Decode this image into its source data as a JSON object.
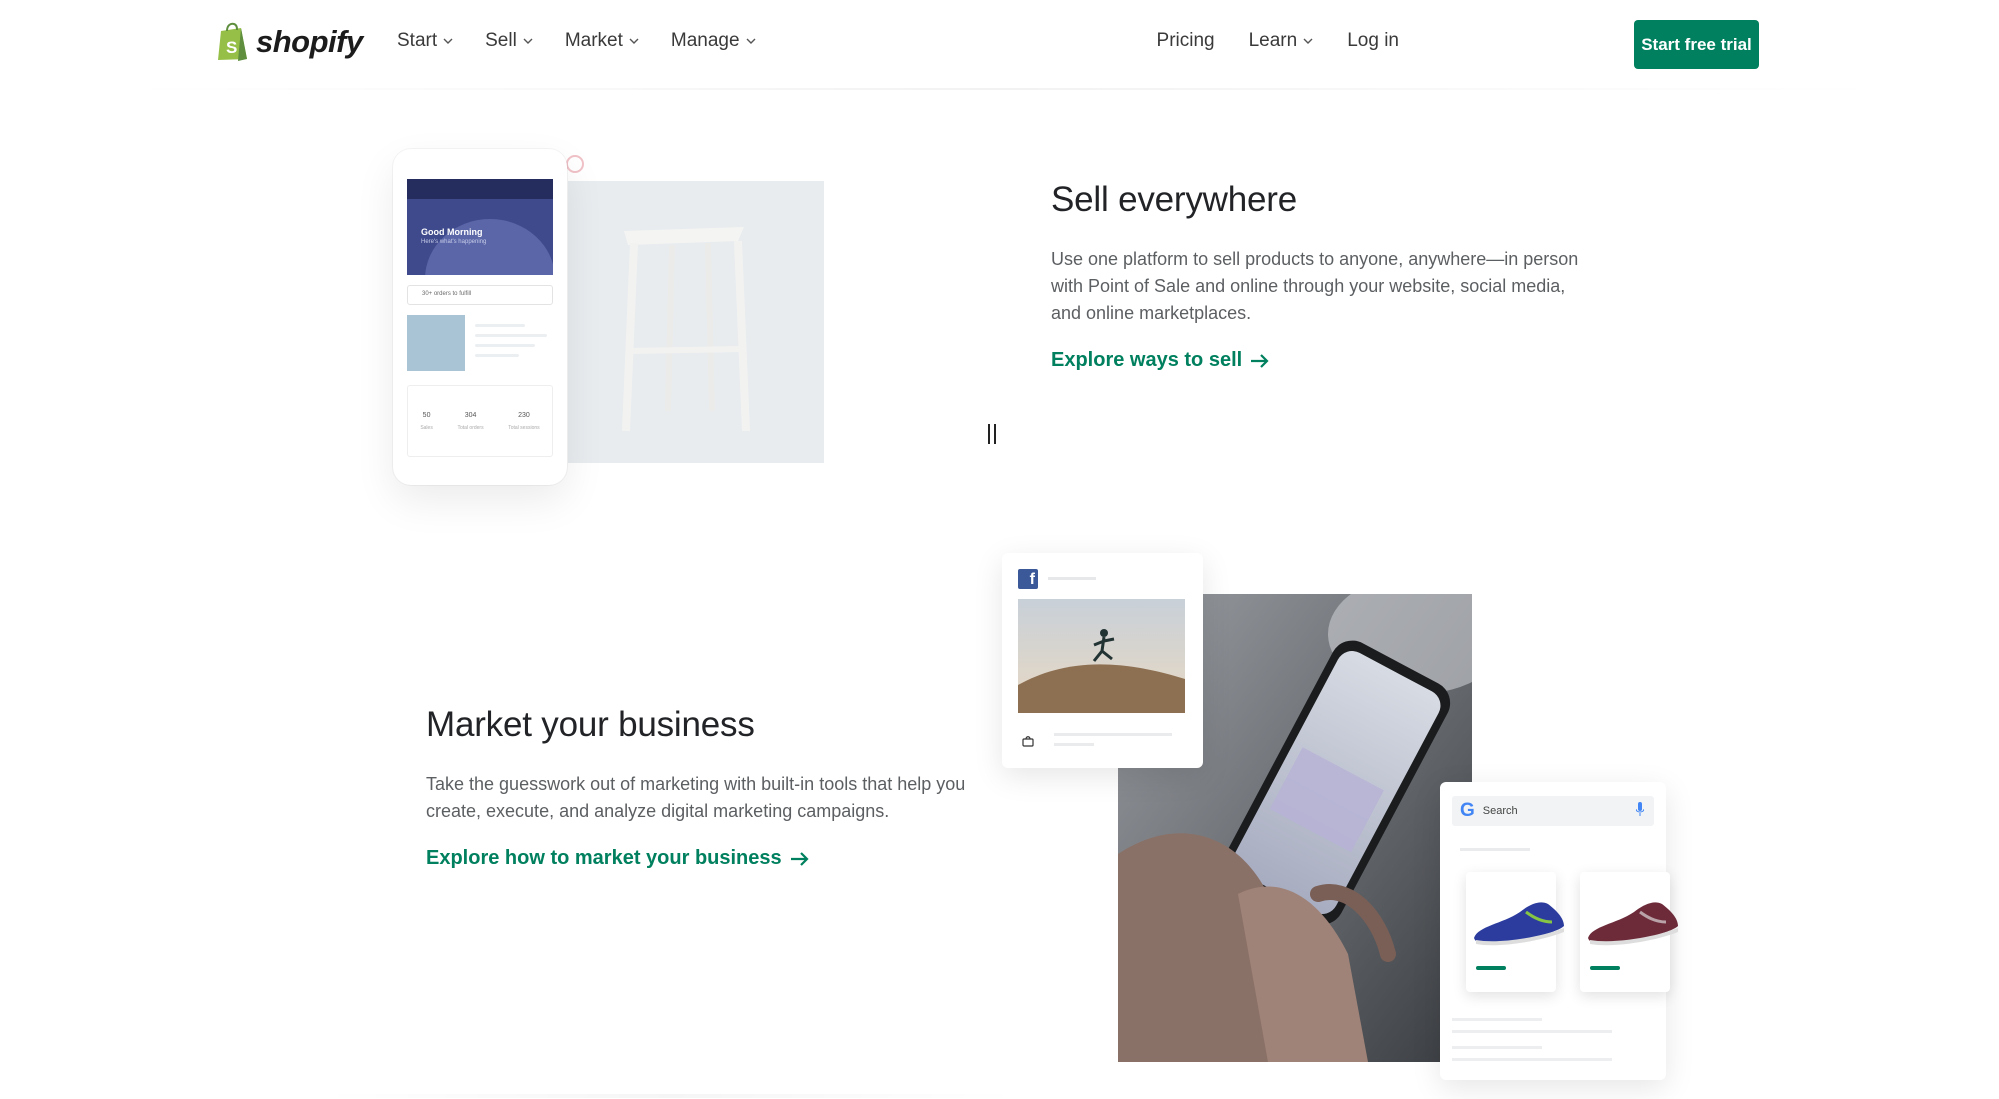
{
  "header": {
    "logo_text": "shopify",
    "nav_left": [
      {
        "label": "Start"
      },
      {
        "label": "Sell"
      },
      {
        "label": "Market"
      },
      {
        "label": "Manage"
      }
    ],
    "pricing": "Pricing",
    "learn": "Learn",
    "login": "Log in",
    "cta": "Start free trial"
  },
  "sell_section": {
    "title": "Sell everywhere",
    "description": "Use one platform to sell products to anyone, anywhere—in person with Point of Sale and online through your website, social media, and online marketplaces.",
    "link": "Explore ways to sell",
    "phone": {
      "greeting": "Good Morning",
      "subtitle": "Here's what's happening",
      "orders": "30+ orders to fulfill",
      "stats": [
        {
          "value": "50",
          "label": "Sales"
        },
        {
          "value": "304",
          "label": "Total orders"
        },
        {
          "value": "230",
          "label": "Total sessions"
        }
      ]
    }
  },
  "market_section": {
    "title": "Market your business",
    "description": "Take the guesswork out of marketing with built-in tools that help you create, execute, and analyze digital marketing campaigns.",
    "link": "Explore how to market your business",
    "search_placeholder": "Search"
  },
  "colors": {
    "brand_green": "#00805e",
    "facebook_blue": "#3b5998",
    "google_blue": "#4285f4"
  },
  "icons": [
    "chevron-down-icon",
    "arrow-right-icon",
    "pause-icon",
    "facebook-icon",
    "google-icon",
    "mic-icon",
    "bag-icon"
  ]
}
